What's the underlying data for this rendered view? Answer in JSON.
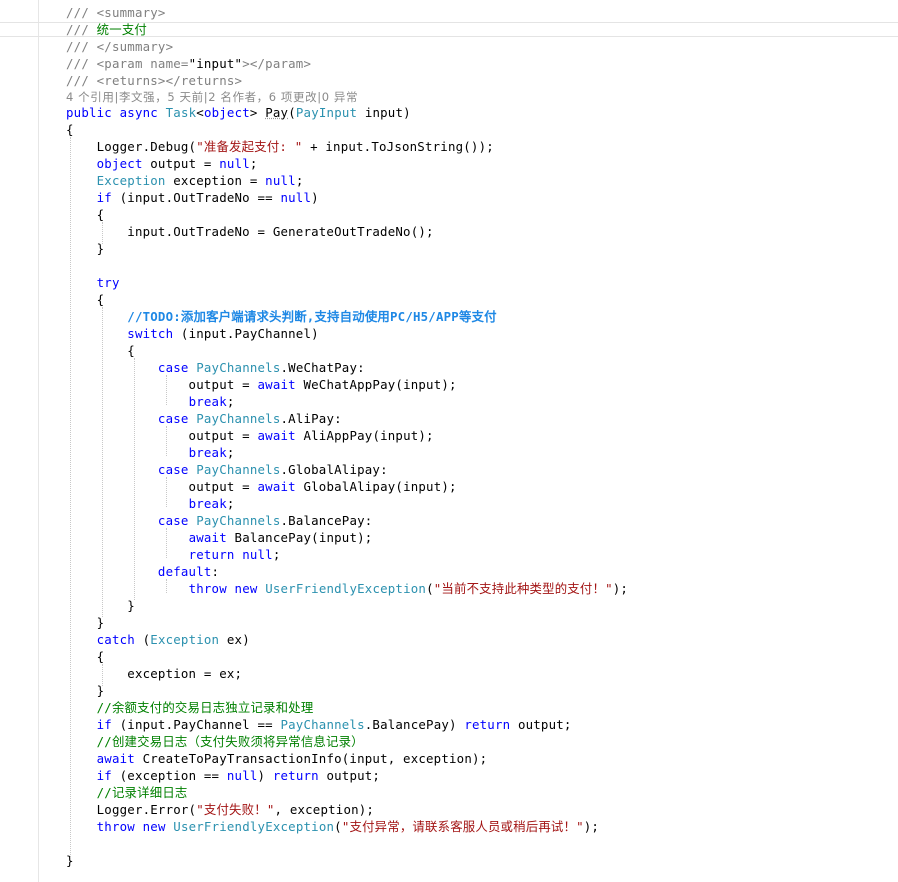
{
  "code": {
    "doc_summary_open": "<summary>",
    "doc_summary_text": "统一支付",
    "doc_summary_close": "</summary>",
    "doc_param_open": "<param name=",
    "doc_param_name": "\"input\"",
    "doc_param_close": "></param>",
    "doc_returns": "<returns></returns>",
    "codelens": "4 个引用|李文强，5 天前|2 名作者，6 项更改|0 异常",
    "method_name": "Pay",
    "param_type": "PayInput",
    "debug_msg": "\"准备发起支付: \"",
    "todo_comment": "//TODO:添加客户端请求头判断,支持自动使用PC/H5/APP等支付",
    "enum_type": "PayChannels",
    "case_wechat": "WeChatPay",
    "call_wechat": "WeChatAppPay",
    "case_alipay": "AliPay",
    "call_alipay": "AliAppPay",
    "case_global": "GlobalAlipay",
    "call_global": "GlobalAlipay",
    "case_balance": "BalancePay",
    "call_balance": "BalancePay",
    "exception_type": "UserFriendlyException",
    "unsupported_msg": "\"当前不支持此种类型的支付！\"",
    "comment_balance": "//余额支付的交易日志独立记录和处理",
    "comment_create_log": "//创建交易日志（支付失败须将异常信息记录）",
    "comment_detail_log": "//记录详细日志",
    "error_msg": "\"支付失败！\"",
    "throw_msg": "\"支付异常，请联系客服人员或稍后再试！\""
  }
}
